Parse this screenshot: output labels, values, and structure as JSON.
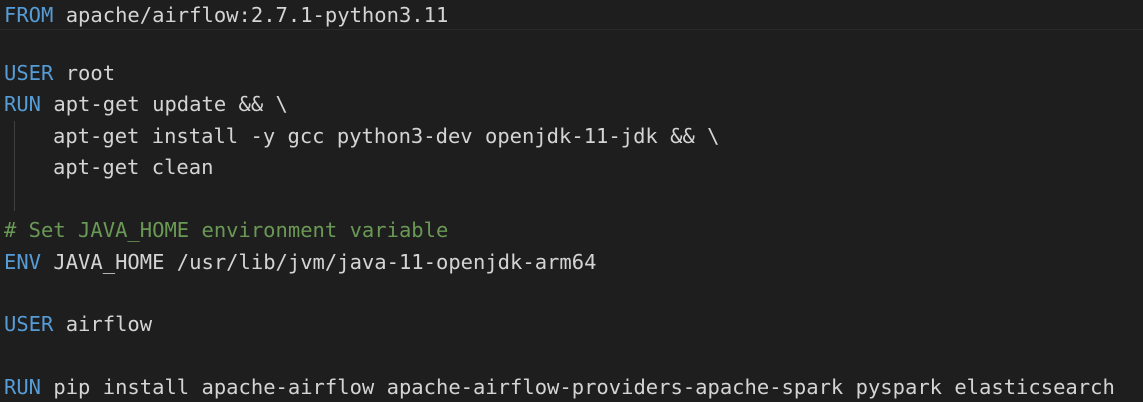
{
  "editor": {
    "language": "dockerfile",
    "colors": {
      "background": "#1e1e1e",
      "keyword": "#569cd6",
      "text": "#d4d4d4",
      "comment": "#6a9955"
    },
    "lines": [
      {
        "keyword": "FROM",
        "text": " apache/airflow:2.7.1-python3.11"
      },
      {
        "keyword": "USER",
        "text": " root"
      },
      {
        "keyword": "RUN",
        "text": " apt-get update && \\"
      },
      {
        "keyword": "",
        "text": "apt-get install -y gcc python3-dev openjdk-11-jdk && \\"
      },
      {
        "keyword": "",
        "text": "apt-get clean"
      },
      {
        "comment": "# Set JAVA_HOME environment variable"
      },
      {
        "keyword": "ENV",
        "text": " JAVA_HOME /usr/lib/jvm/java-11-openjdk-arm64"
      },
      {
        "keyword": "USER",
        "text": " airflow"
      },
      {
        "keyword": "RUN",
        "text": " pip install apache-airflow apache-airflow-providers-apache-spark pyspark elasticsearch"
      }
    ]
  }
}
